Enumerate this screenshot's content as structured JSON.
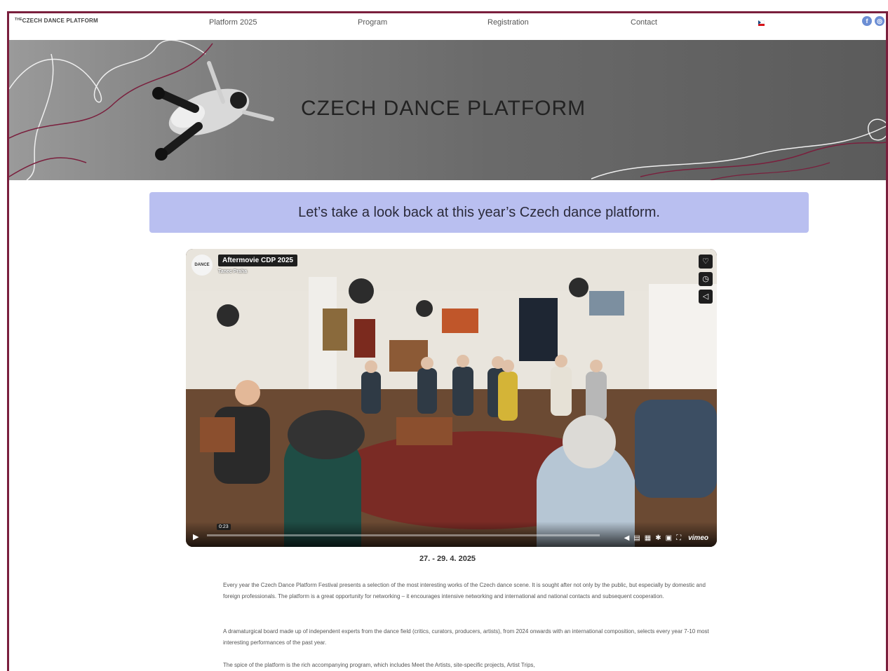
{
  "nav": {
    "logo_prefix": "THE",
    "logo": "CZECH DANCE PLATFORM",
    "links": [
      "Platform 2025",
      "Program",
      "Registration",
      "Contact"
    ],
    "language_flag": "czech-flag-icon",
    "social": [
      {
        "icon": "facebook-icon",
        "glyph": "f"
      },
      {
        "icon": "instagram-icon",
        "glyph": "◎"
      }
    ]
  },
  "hero": {
    "title": "CZECH DANCE PLATFORM"
  },
  "banner": {
    "text": "Let’s take a look back at this year’s Czech dance platform."
  },
  "video": {
    "title": "Aftermovie CDP 2025",
    "channel": "Tanec Praha",
    "badge": "DANCE",
    "time": "0:23",
    "provider": "vimeo",
    "side_icons": [
      "heart-icon",
      "clock-icon",
      "share-icon"
    ],
    "control_icons": [
      "volume-icon",
      "captions-icon",
      "chapters-icon",
      "settings-icon",
      "pip-icon",
      "fullscreen-icon"
    ]
  },
  "event": {
    "dates": "27. - 29. 4. 2025"
  },
  "paragraphs": [
    "Every year the Czech Dance Platform Festival presents a selection of the most interesting works of the Czech dance scene. It is sought after not only by the public, but especially by domestic and foreign professionals. The platform is a great opportunity for networking – it encourages intensive networking and international and national contacts and subsequent cooperation.",
    "A dramaturgical board made up of independent experts from the dance field (critics, curators, producers, artists), from 2024 onwards with an international composition, selects every year 7-10 most interesting performances of the past year.",
    "The spice of the platform is the rich accompanying program, which includes Meet the Artists, site-specific projects, Artist Trips,"
  ],
  "colors": {
    "frame": "#7a1f3d",
    "banner": "#b9bff0",
    "hero_line_dark": "#7a1f3d",
    "hero_line_light": "#ffffff"
  }
}
